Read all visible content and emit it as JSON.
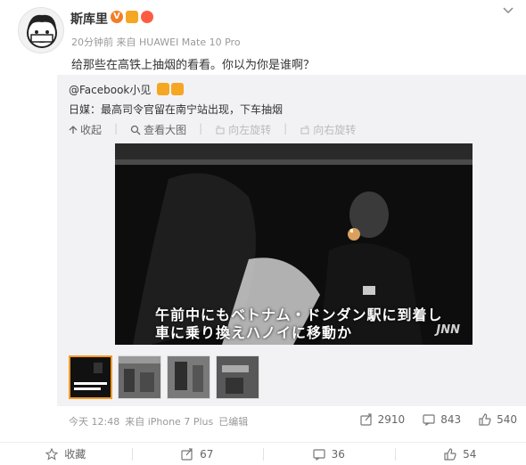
{
  "post": {
    "username": "斯库里",
    "meta": "20分钟前 来自 HUAWEI Mate 10 Pro",
    "text": "给那些在高铁上抽烟的看看。你以为你是谁啊？"
  },
  "repost": {
    "user": "@Facebook小见",
    "text": "日媒：最高司令官留在南宁站出现，下车抽烟",
    "toolbar": {
      "collapse": "收起",
      "view_large": "查看大图",
      "rotate_left": "向左旋转",
      "rotate_right": "向右旋转"
    },
    "image": {
      "subtitle_line1": "午前中にもベトナム・ドンダン駅に到着し",
      "subtitle_line2": "車に乗り換えハノイに移動か",
      "watermark": "JNN"
    },
    "footer": {
      "time": "今天 12:48",
      "source": "来自 iPhone 7 Plus",
      "edited": "已编辑"
    },
    "stats": {
      "reposts": "2910",
      "comments": "843",
      "likes": "540"
    }
  },
  "actions": {
    "favorite": "收藏",
    "repost": "67",
    "comment": "36",
    "like": "54"
  },
  "colors": {
    "accent_orange": "#f59a23",
    "repost_bg": "#f2f2f5",
    "muted_text": "#999999"
  }
}
